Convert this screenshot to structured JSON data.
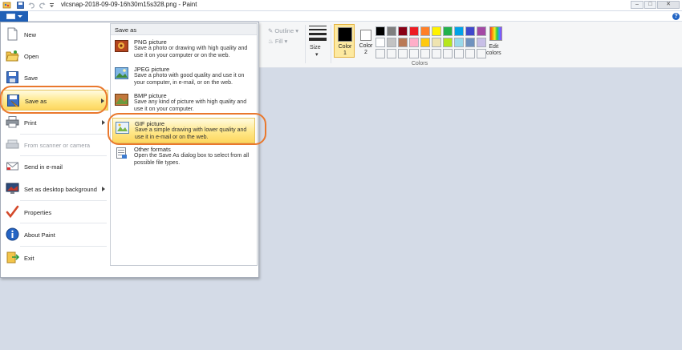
{
  "window": {
    "title": "vlcsnap-2018-09-09-16h30m15s328.png - Paint",
    "minimize": "–",
    "maximize": "□",
    "close": "✕",
    "help": "?"
  },
  "ribbon": {
    "outline_label": "Outline",
    "fill_label": "Fill",
    "size_label": "Size",
    "color1_label": "Color\n1",
    "color2_label": "Color\n2",
    "edit_colors_label": "Edit\ncolors",
    "colors_group_label": "Colors",
    "color1_value": "#000000",
    "color2_value": "#ffffff",
    "palette_row1": [
      "#000000",
      "#7f7f7f",
      "#880015",
      "#ed1c24",
      "#ff7f27",
      "#fff200",
      "#22b14c",
      "#00a2e8",
      "#3f48cc",
      "#a349a4"
    ],
    "palette_row2": [
      "#ffffff",
      "#c3c3c3",
      "#b97a57",
      "#ffaec9",
      "#ffc90e",
      "#efe4b0",
      "#b5e61d",
      "#99d9ea",
      "#7092be",
      "#c8bfe7"
    ]
  },
  "file_menu": {
    "items": [
      {
        "label": "New",
        "icon": "new-file-icon",
        "name": "menu-item-new"
      },
      {
        "label": "Open",
        "icon": "open-folder-icon",
        "name": "menu-item-open"
      },
      {
        "label": "Save",
        "icon": "save-disk-icon",
        "name": "menu-item-save"
      },
      {
        "label": "Save as",
        "icon": "save-as-icon",
        "name": "menu-item-save-as"
      },
      {
        "label": "Print",
        "icon": "printer-icon",
        "name": "menu-item-print"
      },
      {
        "label": "From scanner or camera",
        "icon": "scanner-icon",
        "name": "menu-item-scanner"
      },
      {
        "label": "Send in e-mail",
        "icon": "email-icon",
        "name": "menu-item-email"
      },
      {
        "label": "Set as desktop background",
        "icon": "desktop-background-icon",
        "name": "menu-item-desktop-background"
      },
      {
        "label": "Properties",
        "icon": "properties-checkmark-icon",
        "name": "menu-item-properties"
      },
      {
        "label": "About Paint",
        "icon": "info-icon",
        "name": "menu-item-about"
      },
      {
        "label": "Exit",
        "icon": "exit-icon",
        "name": "menu-item-exit"
      }
    ]
  },
  "save_as": {
    "header": "Save as",
    "items": [
      {
        "title": "PNG picture",
        "desc": "Save a photo or drawing with high quality and use it on your computer or on the web."
      },
      {
        "title": "JPEG picture",
        "desc": "Save a photo with good quality and use it on your computer, in e-mail, or on the web."
      },
      {
        "title": "BMP picture",
        "desc": "Save any kind of picture with high quality and use it on your computer."
      },
      {
        "title": "GIF picture",
        "desc": "Save a simple drawing with lower quality and use it in e-mail or on the web."
      },
      {
        "title": "Other formats",
        "desc": "Open the Save As dialog box to select from all possible file types."
      }
    ]
  }
}
